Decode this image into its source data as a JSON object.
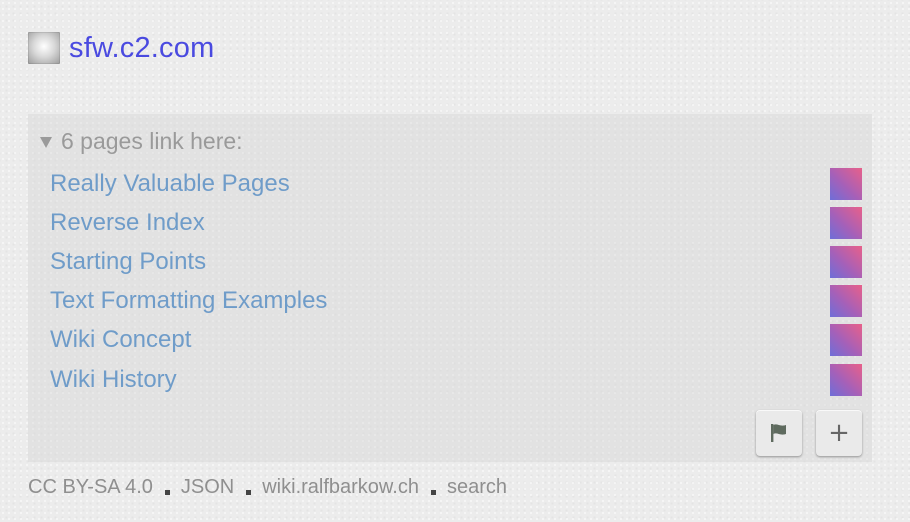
{
  "site": {
    "title": "sfw.c2.com",
    "favicon": "site-favicon"
  },
  "references": {
    "header": "6 pages link here:",
    "items": [
      {
        "label": "Really Valuable Pages"
      },
      {
        "label": "Reverse Index"
      },
      {
        "label": "Starting Points"
      },
      {
        "label": "Text Formatting Examples"
      },
      {
        "label": "Wiki Concept"
      },
      {
        "label": "Wiki History"
      }
    ],
    "link_color": "#6f9cc9",
    "swatch_colors": [
      "#6e6ed8",
      "#e8608a"
    ]
  },
  "buttons": {
    "flag_icon": "flag-icon",
    "add_label": "+"
  },
  "footer": {
    "license": "CC BY-SA 4.0",
    "json": "JSON",
    "host": "wiki.ralfbarkow.ch",
    "search": "search"
  },
  "colors": {
    "title": "#4a4ae0",
    "muted": "#9a9a9a",
    "background": "#ececec"
  }
}
